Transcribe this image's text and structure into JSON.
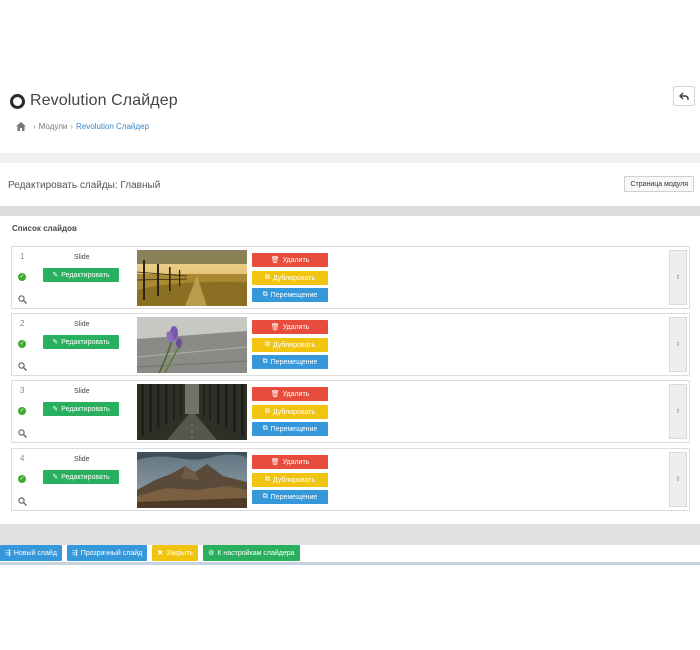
{
  "header": {
    "title": "Revolution Слайдер",
    "back_icon": "undo-icon"
  },
  "breadcrumb": {
    "home_icon": "home-icon",
    "modules": "Модули",
    "current": "Revolution Слайдер"
  },
  "edit_section": {
    "title": "Редактировать слайды: Главный",
    "module_page_label": "Страница модуля"
  },
  "slide_list": {
    "title": "Список слайдов",
    "edit_label": "Редактировать",
    "delete_label": "Удалить",
    "duplicate_label": "Дублировать",
    "move_label": "Перемещение",
    "handle_glyph": "⇕",
    "slides": [
      {
        "number": "1",
        "name": "Slide",
        "image": "field-fence-sunset"
      },
      {
        "number": "2",
        "name": "Slide",
        "image": "purple-flower-road"
      },
      {
        "number": "3",
        "name": "Slide",
        "image": "dark-forest-road"
      },
      {
        "number": "4",
        "name": "Slide",
        "image": "mountain-landscape"
      }
    ]
  },
  "bottom_buttons": {
    "new_slide": "Новый слайд",
    "transparent_slide": "Прозрачный слайд",
    "close": "Закрыть",
    "slider_settings": "К настройкам слайдера"
  },
  "colors": {
    "green": "#29b05f",
    "red": "#e74c3c",
    "yellow": "#f1c40f",
    "blue": "#3498db",
    "link": "#3a87c8"
  }
}
